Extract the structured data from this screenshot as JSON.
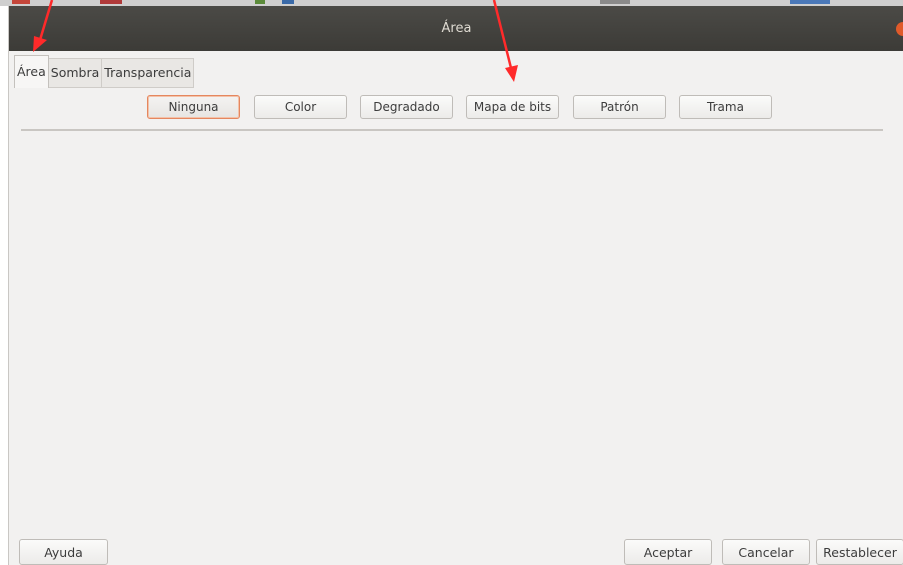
{
  "window": {
    "title": "Área"
  },
  "tabs": [
    {
      "label": "Área",
      "active": true
    },
    {
      "label": "Sombra",
      "active": false
    },
    {
      "label": "Transparencia",
      "active": false
    }
  ],
  "fill_options": [
    {
      "label": "Ninguna",
      "selected": true
    },
    {
      "label": "Color",
      "selected": false
    },
    {
      "label": "Degradado",
      "selected": false
    },
    {
      "label": "Mapa de bits",
      "selected": false
    },
    {
      "label": "Patrón",
      "selected": false
    },
    {
      "label": "Trama",
      "selected": false
    }
  ],
  "footer": {
    "help_label": "Ayuda",
    "ok_label": "Aceptar",
    "cancel_label": "Cancelar",
    "reset_label": "Restablecer"
  },
  "colors": {
    "titlebar": "#3c3b37",
    "dialog_background": "#f2f1f0",
    "close_button": "#e05a2a",
    "selected_outline": "#e5875f",
    "annotation_arrows": "#ff2a2a"
  },
  "annotations": {
    "arrow_count": 2,
    "pointing_to": [
      "tab-area",
      "fill-mapa-de-bits-button"
    ]
  }
}
